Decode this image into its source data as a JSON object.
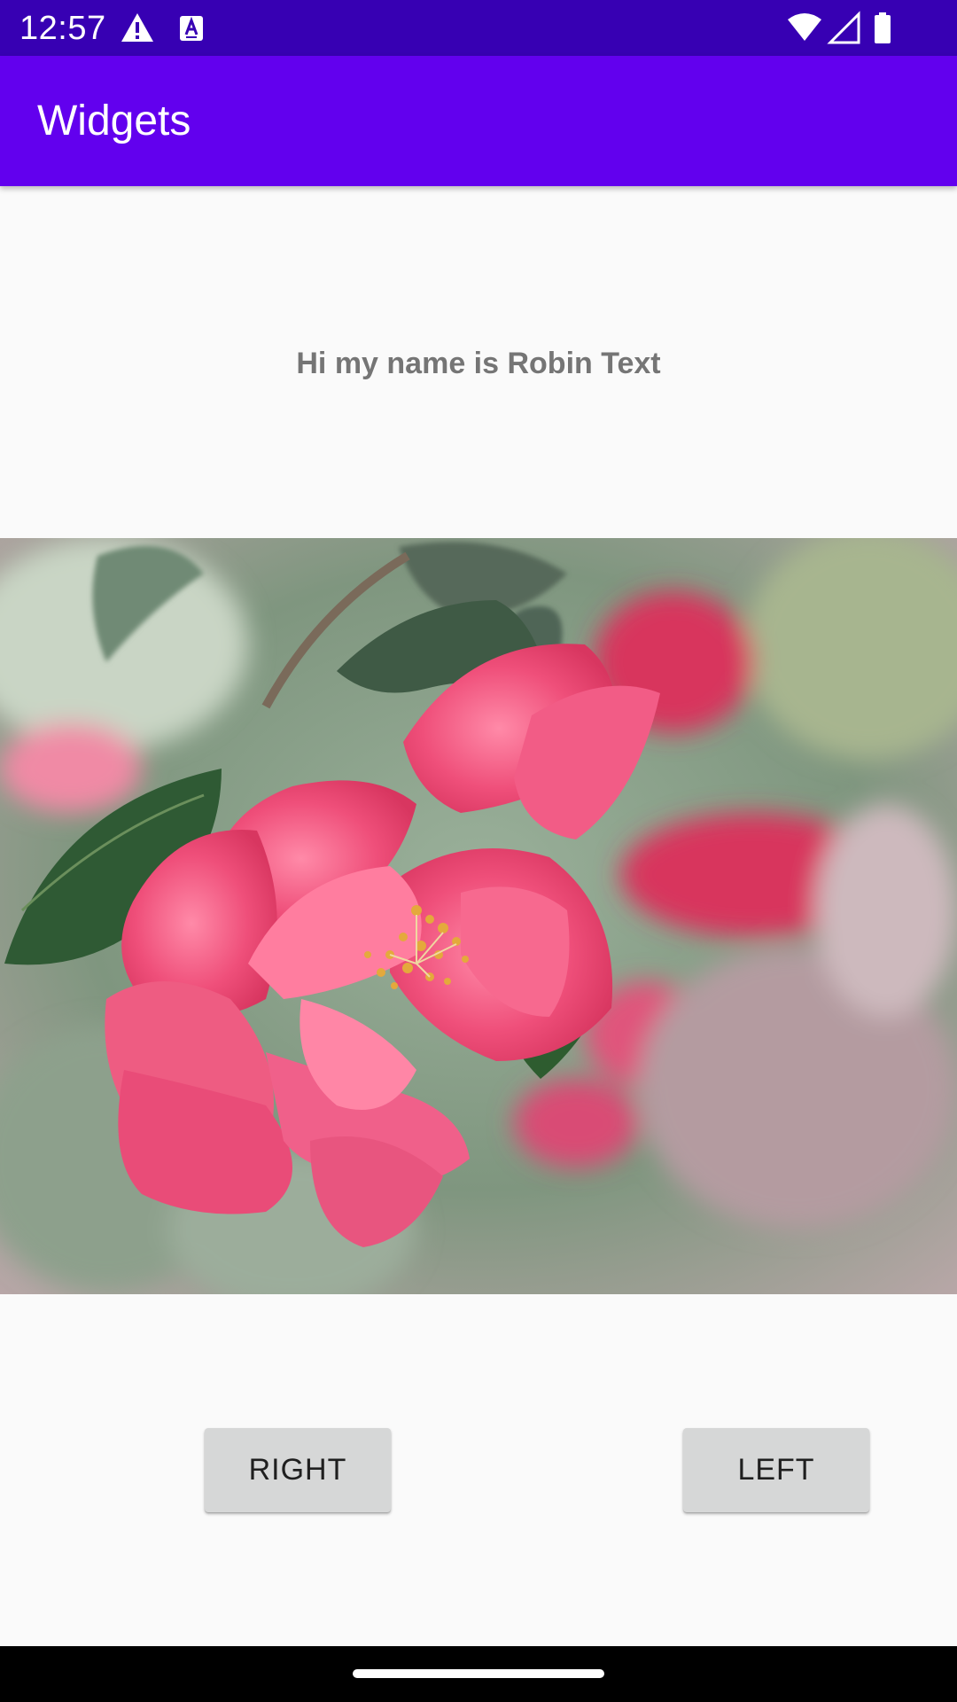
{
  "status_bar": {
    "time": "12:57",
    "left_icons": [
      "warning-icon",
      "keyboard-a-icon"
    ],
    "right_icons": [
      "wifi-icon",
      "signal-icon",
      "battery-icon"
    ],
    "background": "#3700b3"
  },
  "app_bar": {
    "title": "Widgets",
    "background": "#6200ee"
  },
  "content": {
    "greeting": "Hi my name is Robin Text",
    "image_subject": "pink camellia flower with green leaves"
  },
  "buttons": {
    "right_label": "RIGHT",
    "left_label": "LEFT"
  },
  "nav_bar": {
    "handle_icon": "home-handle"
  }
}
